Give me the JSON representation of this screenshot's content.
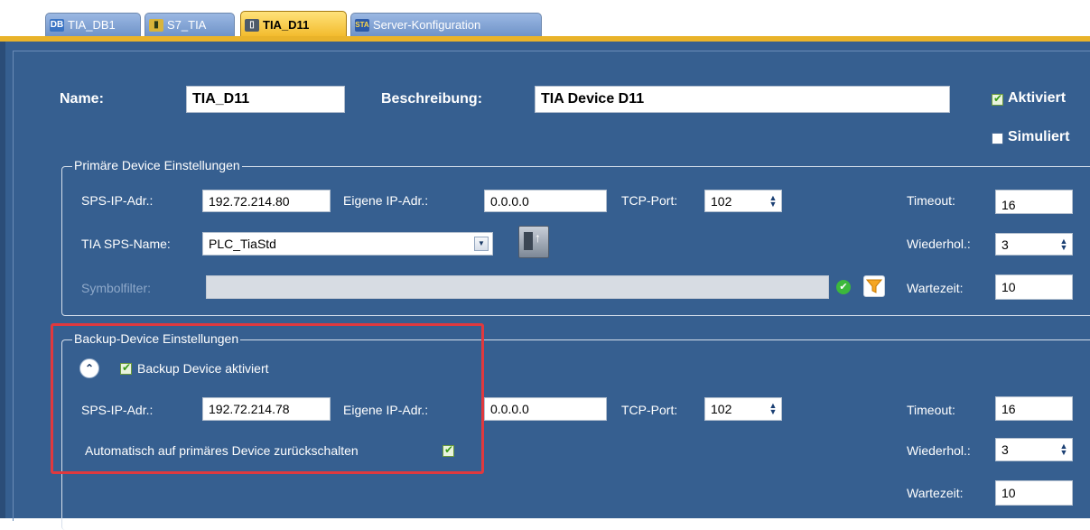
{
  "tabs": [
    {
      "label": "TIA_DB1",
      "icon": "db-icon"
    },
    {
      "label": "S7_TIA",
      "icon": "plc-icon"
    },
    {
      "label": "TIA_D11",
      "icon": "device-icon"
    },
    {
      "label": "Server-Konfiguration",
      "icon": "server-icon"
    }
  ],
  "header": {
    "name_label": "Name:",
    "name_value": "TIA_D11",
    "desc_label": "Beschreibung:",
    "desc_value": "TIA Device D11",
    "aktiviert_label": "Aktiviert",
    "aktiviert_checked": true,
    "simuliert_label": "Simuliert",
    "simuliert_checked": false
  },
  "primary": {
    "legend": "Primäre Device Einstellungen",
    "sps_ip_label": "SPS-IP-Adr.:",
    "sps_ip_value": "192.72.214.80",
    "own_ip_label": "Eigene IP-Adr.:",
    "own_ip_value": "0.0.0.0",
    "tcp_port_label": "TCP-Port:",
    "tcp_port_value": "102",
    "tia_name_label": "TIA SPS-Name:",
    "tia_name_value": "PLC_TiaStd",
    "symbolfilter_label": "Symbolfilter:",
    "symbolfilter_value": "",
    "timeout_label": "Timeout:",
    "timeout_value": "16",
    "wiederhol_label": "Wiederhol.:",
    "wiederhol_value": "3",
    "wartezeit_label": "Wartezeit:",
    "wartezeit_value": "10"
  },
  "backup": {
    "legend": "Backup-Device Einstellungen",
    "enabled_label": "Backup Device aktiviert",
    "enabled_checked": true,
    "sps_ip_label": "SPS-IP-Adr.:",
    "sps_ip_value": "192.72.214.78",
    "own_ip_label": "Eigene IP-Adr.:",
    "own_ip_value": "0.0.0.0",
    "tcp_port_label": "TCP-Port:",
    "tcp_port_value": "102",
    "auto_switch_label": "Automatisch auf primäres Device zurückschalten",
    "auto_switch_checked": true,
    "timeout_label": "Timeout:",
    "timeout_value": "16",
    "wiederhol_label": "Wiederhol.:",
    "wiederhol_value": "3",
    "wartezeit_label": "Wartezeit:",
    "wartezeit_value": "10"
  },
  "colors": {
    "panel": "#365f90",
    "active_tab": "#f2b928",
    "highlight": "#e0393e"
  }
}
